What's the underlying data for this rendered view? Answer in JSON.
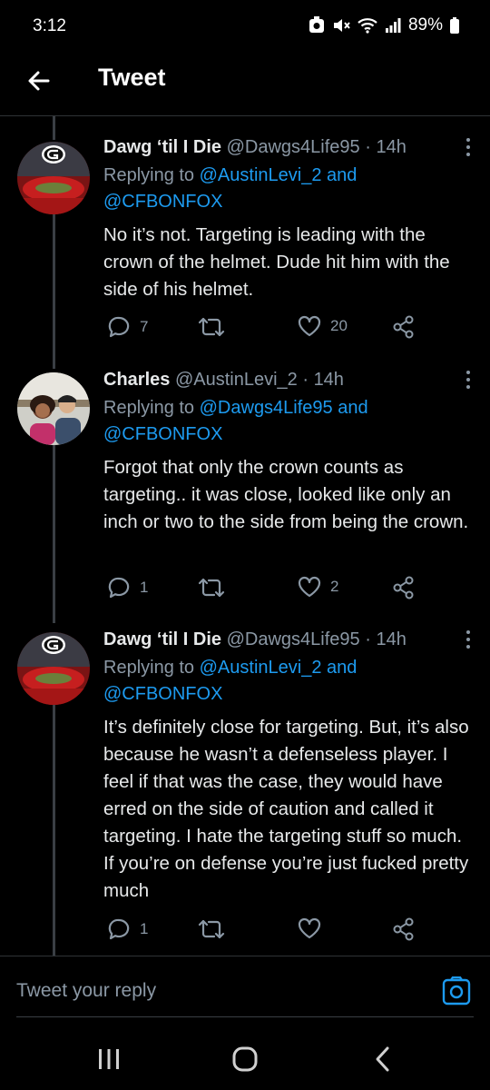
{
  "status": {
    "time": "3:12",
    "battery": "89%"
  },
  "header": {
    "title": "Tweet"
  },
  "tweets": [
    {
      "name": "Dawg ‘til I Die",
      "handle": "@Dawgs4Life95",
      "sep": "·",
      "time": "14h",
      "replying_prefix": "Replying to",
      "reply_user1": "@AustinLevi_2",
      "reply_and": "and",
      "reply_user2": "@CFBONFOX",
      "text": "No it’s not. Targeting is leading with the crown of the helmet. Dude hit him with the side of his helmet.",
      "replies": "7",
      "retweets": "",
      "likes": "20"
    },
    {
      "name": "Charles",
      "handle": "@AustinLevi_2",
      "sep": "·",
      "time": "14h",
      "replying_prefix": "Replying to",
      "reply_user1": "@Dawgs4Life95",
      "reply_and": "and",
      "reply_user2": "@CFBONFOX",
      "text": "Forgot that only the crown counts as targeting.. it was close, looked like only an inch or two to the side from being the crown.",
      "replies": "1",
      "retweets": "",
      "likes": "2"
    },
    {
      "name": "Dawg ‘til I Die",
      "handle": "@Dawgs4Life95",
      "sep": "·",
      "time": "14h",
      "replying_prefix": "Replying to",
      "reply_user1": "@AustinLevi_2",
      "reply_and": "and",
      "reply_user2": "@CFBONFOX",
      "text": "It’s definitely close for targeting. But, it’s also because he wasn’t a defenseless player. I feel if that was the case, they would have erred on the side of caution and called it targeting. I hate the targeting stuff so much. If you’re on defense you’re just fucked pretty much",
      "replies": "1",
      "retweets": "",
      "likes": ""
    }
  ],
  "reply_box": {
    "placeholder": "Tweet your reply"
  },
  "colors": {
    "accent": "#1d9bf0",
    "muted": "#8b98a5",
    "text": "#e7e9ea",
    "background": "#000000"
  },
  "icons": [
    "back-arrow-icon",
    "more-icon",
    "reply-icon",
    "retweet-icon",
    "like-icon",
    "share-icon",
    "camera-icon",
    "recents-icon",
    "home-icon",
    "back-icon"
  ]
}
